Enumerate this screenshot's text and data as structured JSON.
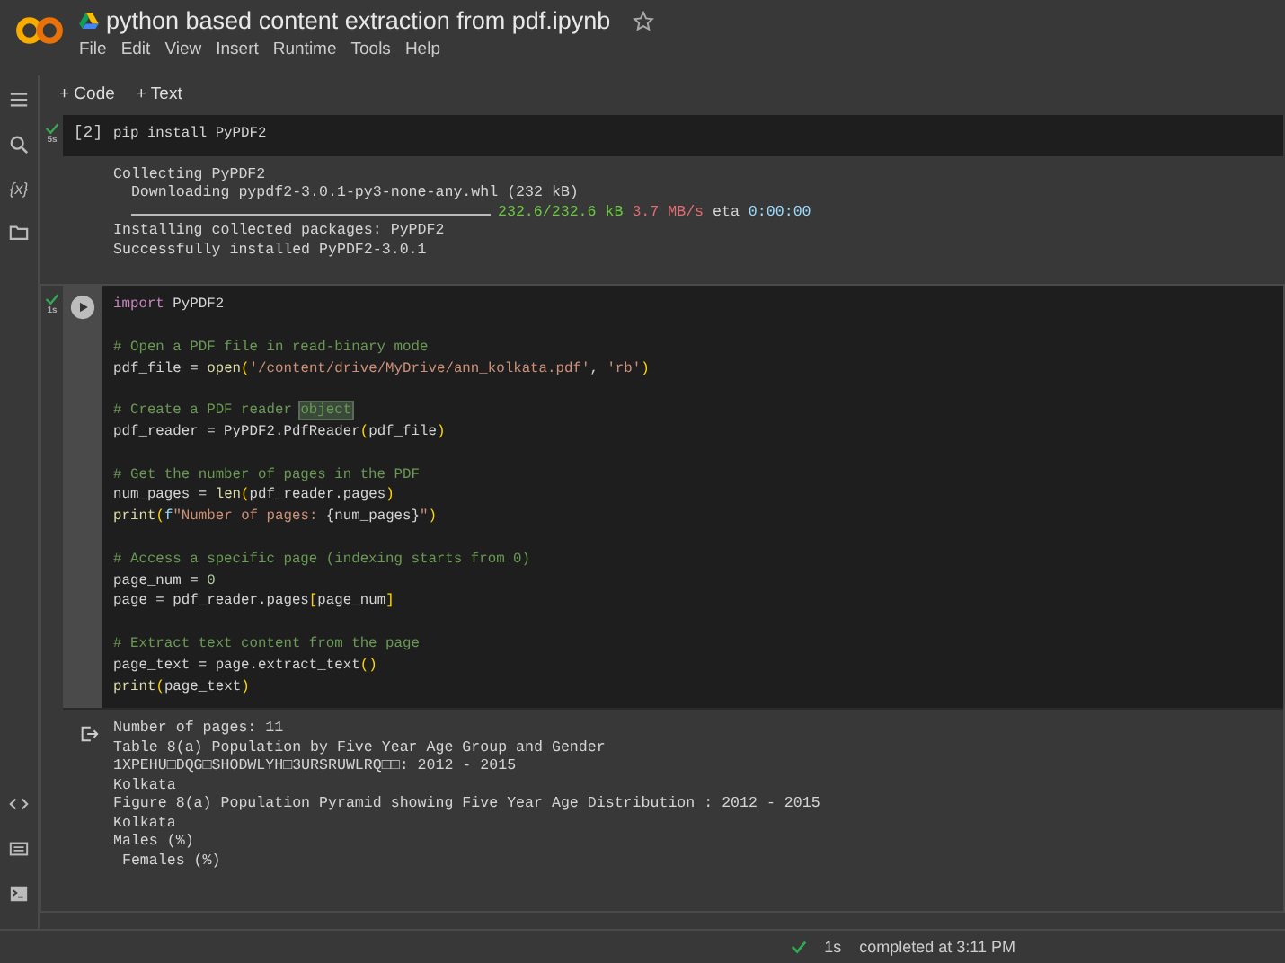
{
  "header": {
    "title": "python based content extraction from pdf.ipynb",
    "menu": [
      "File",
      "Edit",
      "View",
      "Insert",
      "Runtime",
      "Tools",
      "Help"
    ]
  },
  "sidebar": {
    "top_icons": [
      {
        "kind": "menu"
      },
      {
        "kind": "search"
      },
      {
        "kind": "variables",
        "label": "{x}"
      },
      {
        "kind": "folder"
      }
    ],
    "bottom_icons": [
      {
        "kind": "code"
      },
      {
        "kind": "keyboard"
      },
      {
        "kind": "terminal"
      }
    ]
  },
  "toolbar": [
    "+ Code",
    "+ Text"
  ],
  "cells": [
    {
      "status": "5s",
      "prompt": {
        "kind": "count",
        "text": "[2]"
      },
      "focused": false,
      "blocks": [
        [
          [
            {
              "text": "pip install PyPDF2",
              "kind": "plain"
            }
          ]
        ]
      ],
      "output": {
        "icon": false,
        "lines": [
          {
            "kind": "text",
            "tokens": [
              {
                "text": "Collecting PyPDF2",
                "kind": "plain"
              }
            ]
          },
          {
            "kind": "text",
            "tokens": [
              {
                "text": "  Downloading pypdf2-3.0.1-py3-none-any.whl (232 kB)",
                "kind": "plain"
              }
            ]
          },
          {
            "kind": "progress",
            "level": 1,
            "tokens": [
              {
                "text": "232.6/232.6 kB",
                "kind": "green"
              },
              {
                "text": " 3.7 MB/s",
                "kind": "red"
              },
              {
                "text": " eta",
                "kind": "plain"
              },
              {
                "text": " 0:00:00",
                "kind": "blue"
              }
            ]
          },
          {
            "kind": "text",
            "tokens": [
              {
                "text": "Installing collected packages: PyPDF2",
                "kind": "plain"
              }
            ]
          },
          {
            "kind": "text",
            "tokens": [
              {
                "text": "Successfully installed PyPDF2-3.0.1",
                "kind": "plain"
              }
            ]
          }
        ]
      }
    },
    {
      "status": "1s",
      "prompt": {
        "kind": "run"
      },
      "focused": true,
      "blocks": [
        [
          [
            {
              "text": "import",
              "kind": "keyword"
            },
            {
              "text": " PyPDF2",
              "kind": "plain"
            }
          ]
        ],
        [
          [
            {
              "text": "# Open a PDF file in read-binary mode",
              "kind": "comment"
            }
          ],
          [
            {
              "text": "pdf_file = ",
              "kind": "plain"
            },
            {
              "text": "open",
              "kind": "func"
            },
            {
              "text": "(",
              "kind": "bracket"
            },
            {
              "text": "'/content/drive/MyDrive/ann_kolkata.pdf'",
              "kind": "string"
            },
            {
              "text": ", ",
              "kind": "plain"
            },
            {
              "text": "'rb'",
              "kind": "string"
            },
            {
              "text": ")",
              "kind": "bracket"
            }
          ]
        ],
        [
          [
            {
              "text": "# Create a PDF reader ",
              "kind": "comment"
            },
            {
              "text": "object",
              "kind": "selection"
            }
          ],
          [
            {
              "text": "pdf_reader = PyPDF2.PdfReader",
              "kind": "plain"
            },
            {
              "text": "(",
              "kind": "bracket"
            },
            {
              "text": "pdf_file",
              "kind": "plain"
            },
            {
              "text": ")",
              "kind": "bracket"
            }
          ]
        ],
        [
          [
            {
              "text": "# Get the number of pages in the PDF",
              "kind": "comment"
            }
          ],
          [
            {
              "text": "num_pages = ",
              "kind": "plain"
            },
            {
              "text": "len",
              "kind": "func"
            },
            {
              "text": "(",
              "kind": "bracket"
            },
            {
              "text": "pdf_reader.pages",
              "kind": "plain"
            },
            {
              "text": ")",
              "kind": "bracket"
            }
          ],
          [
            {
              "text": "print",
              "kind": "func"
            },
            {
              "text": "(",
              "kind": "bracket"
            },
            {
              "text": "f",
              "kind": "blue"
            },
            {
              "text": "\"Number of pages: ",
              "kind": "string"
            },
            {
              "text": "{num_pages}",
              "kind": "plain"
            },
            {
              "text": "\"",
              "kind": "string"
            },
            {
              "text": ")",
              "kind": "bracket"
            }
          ]
        ],
        [
          [
            {
              "text": "# Access a specific page (indexing starts from 0)",
              "kind": "comment"
            }
          ],
          [
            {
              "text": "page_num = ",
              "kind": "plain"
            },
            {
              "text": "0",
              "kind": "number"
            }
          ],
          [
            {
              "text": "page = pdf_reader.pages",
              "kind": "plain"
            },
            {
              "text": "[",
              "kind": "bracket"
            },
            {
              "text": "page_num",
              "kind": "plain"
            },
            {
              "text": "]",
              "kind": "bracket"
            }
          ]
        ],
        [
          [
            {
              "text": "# Extract text content from the page",
              "kind": "comment"
            }
          ],
          [
            {
              "text": "page_text = page.extract_text",
              "kind": "plain"
            },
            {
              "text": "()",
              "kind": "bracket"
            }
          ],
          [
            {
              "text": "print",
              "kind": "func"
            },
            {
              "text": "(",
              "kind": "bracket"
            },
            {
              "text": "page_text",
              "kind": "plain"
            },
            {
              "text": ")",
              "kind": "bracket"
            }
          ]
        ]
      ],
      "output": {
        "icon": true,
        "lines": [
          {
            "kind": "text",
            "tokens": [
              {
                "text": "Number of pages: 11",
                "kind": "plain"
              }
            ]
          },
          {
            "kind": "text",
            "tokens": [
              {
                "text": "Table 8(a) Population by Five Year Age Group and Gender",
                "kind": "plain"
              }
            ]
          },
          {
            "kind": "text",
            "tokens": [
              {
                "text": "1XPEHU□DQG□SHODWLYH□3URSRUWLRQ□□: 2012 - 2015",
                "kind": "plain"
              }
            ]
          },
          {
            "kind": "text",
            "tokens": [
              {
                "text": "Kolkata",
                "kind": "plain"
              }
            ]
          },
          {
            "kind": "text",
            "tokens": [
              {
                "text": "Figure 8(a) Population Pyramid showing Five Year Age Distribution : 2012 - 2015",
                "kind": "plain"
              }
            ]
          },
          {
            "kind": "text",
            "tokens": [
              {
                "text": "Kolkata",
                "kind": "plain"
              }
            ]
          },
          {
            "kind": "text",
            "tokens": [
              {
                "text": "Males (%)",
                "kind": "plain"
              }
            ]
          },
          {
            "kind": "text",
            "tokens": [
              {
                "text": " Females (%)",
                "kind": "plain"
              }
            ]
          }
        ]
      }
    }
  ],
  "status_bar": {
    "duration": "1s",
    "message": "completed at 3:11 PM"
  }
}
